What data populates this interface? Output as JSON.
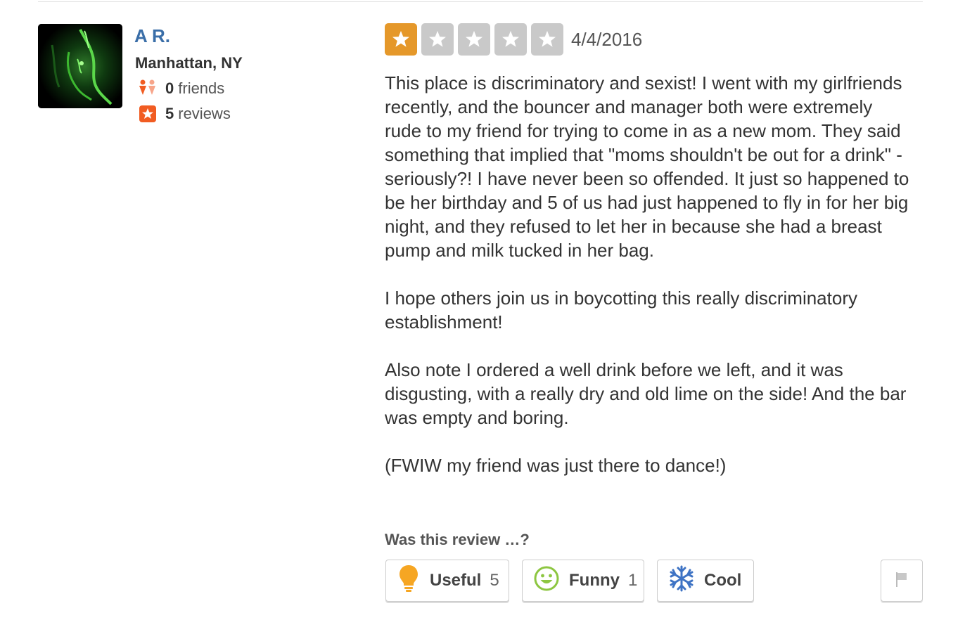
{
  "user": {
    "name": "A R.",
    "location": "Manhattan, NY",
    "friends_count": "0",
    "friends_label": "friends",
    "reviews_count": "5",
    "reviews_label": "reviews"
  },
  "review": {
    "rating": 1,
    "rating_max": 5,
    "date": "4/4/2016",
    "paragraphs": [
      "This place is discriminatory and sexist! I went with my girlfriends recently, and the bouncer and manager both were extremely rude to my friend for trying to come in as a new mom. They said something that implied that \"moms shouldn't be out for a drink\" - seriously?! I have never been so offended. It just so happened to be her birthday and 5 of us had just happened to fly in for her big night, and they refused to let her in because she had a breast pump and milk tucked in her bag.",
      "I hope others join us in boycotting this really discriminatory establishment!",
      "Also note I ordered a well drink before we left, and it was disgusting, with a really dry and old lime on the side! And the bar was empty and boring.",
      "(FWIW my friend was just there to dance!)"
    ]
  },
  "votes": {
    "question": "Was this review …?",
    "useful_label": "Useful",
    "useful_count": "5",
    "funny_label": "Funny",
    "funny_count": "1",
    "cool_label": "Cool",
    "cool_count": ""
  },
  "icons": {
    "friends": "friends-icon",
    "reviews": "star-badge-icon",
    "useful": "lightbulb-icon",
    "funny": "smiley-icon",
    "cool": "snowflake-icon",
    "flag": "flag-icon"
  },
  "colors": {
    "user_link": "#3a6ea8",
    "star_on": "#e5982a",
    "star_off": "#c9c9c9",
    "accent_orange": "#f15c22"
  }
}
